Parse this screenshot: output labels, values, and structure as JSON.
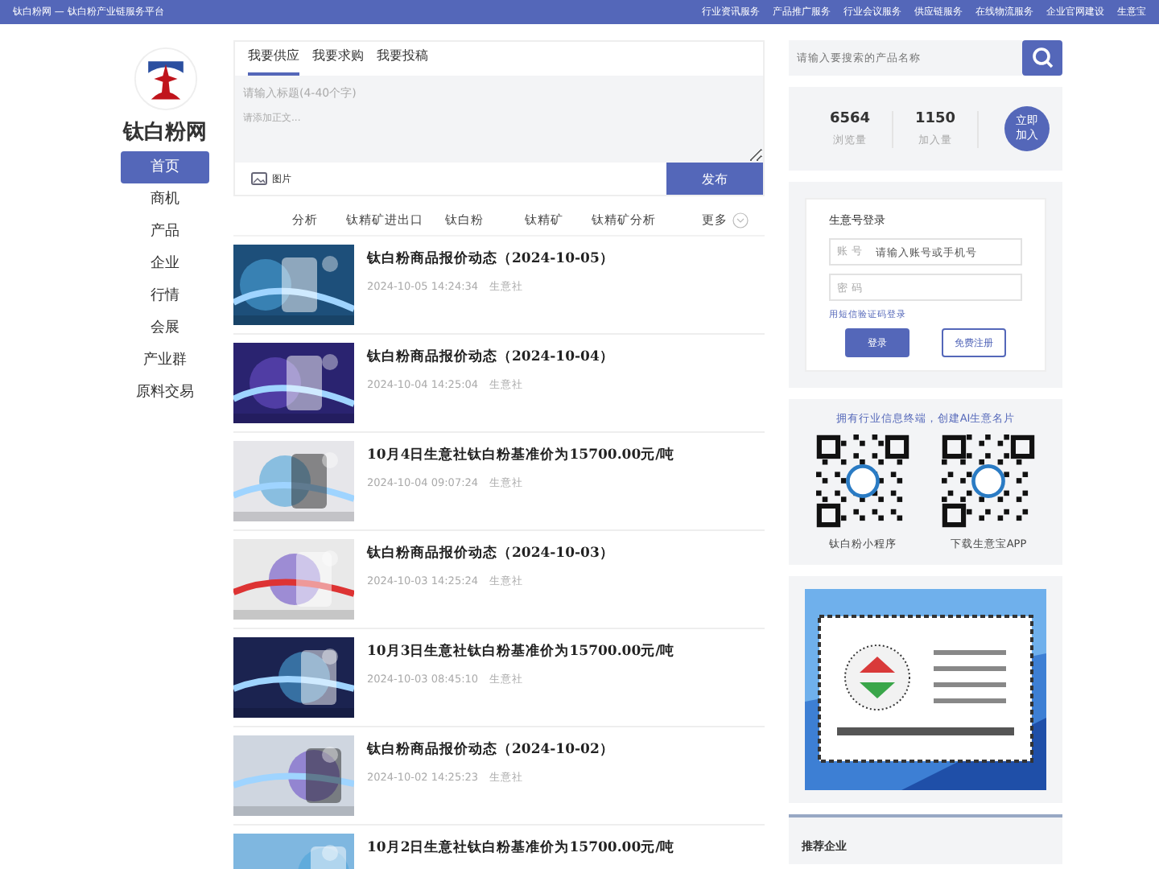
{
  "top_bar": {
    "site_title": "钛白粉网 — 钛白粉产业链服务平台",
    "links": [
      "行业资讯服务",
      "产品推广服务",
      "行业会议服务",
      "供应链服务",
      "在线物流服务",
      "企业官网建设",
      "生意宝"
    ]
  },
  "sidebar": {
    "site_name": "钛白粉网",
    "nav": [
      {
        "label": "首页",
        "selected": true
      },
      {
        "label": "商机",
        "selected": false
      },
      {
        "label": "产品",
        "selected": false
      },
      {
        "label": "企业",
        "selected": false
      },
      {
        "label": "行情",
        "selected": false
      },
      {
        "label": "会展",
        "selected": false
      },
      {
        "label": "产业群",
        "selected": false
      },
      {
        "label": "原料交易",
        "selected": false
      }
    ]
  },
  "post_box": {
    "tabs": [
      {
        "label": "我要供应",
        "selected": true
      },
      {
        "label": "我要求购",
        "selected": false
      },
      {
        "label": "我要投稿",
        "selected": false
      }
    ],
    "title_placeholder": "请输入标题(4-40个字)",
    "body_placeholder": "请添加正文...",
    "image_label": "图片",
    "submit": "发布"
  },
  "categories": {
    "items": [
      "分析",
      "钛精矿进出口",
      "钛白粉",
      "钛精矿",
      "钛精矿分析"
    ],
    "more": "更多"
  },
  "news": [
    {
      "title": "钛白粉商品报价动态（2024-10-05）",
      "time": "2024-10-05 14:24:34",
      "source": "生意社"
    },
    {
      "title": "钛白粉商品报价动态（2024-10-04）",
      "time": "2024-10-04 14:25:04",
      "source": "生意社"
    },
    {
      "title": "10月4日生意社钛白粉基准价为15700.00元/吨",
      "time": "2024-10-04 09:07:24",
      "source": "生意社"
    },
    {
      "title": "钛白粉商品报价动态（2024-10-03）",
      "time": "2024-10-03 14:25:24",
      "source": "生意社"
    },
    {
      "title": "10月3日生意社钛白粉基准价为15700.00元/吨",
      "time": "2024-10-03 08:45:10",
      "source": "生意社"
    },
    {
      "title": "钛白粉商品报价动态（2024-10-02）",
      "time": "2024-10-02 14:25:23",
      "source": "生意社"
    },
    {
      "title": "10月2日生意社钛白粉基准价为15700.00元/吨"
    }
  ],
  "search": {
    "placeholder": "请输入要搜索的产品名称"
  },
  "stats": {
    "items": [
      {
        "value": "6564",
        "label": "浏览量"
      },
      {
        "value": "1150",
        "label": "加入量"
      }
    ],
    "join_button": "立即加入"
  },
  "login": {
    "title": "生意号登录",
    "account_label": "账 号",
    "account_placeholder": "请输入账号或手机号",
    "password_placeholder": "密 码",
    "sms_link": "用短信验证码登录",
    "login_button": "登录",
    "register_button": "免费注册"
  },
  "apps": {
    "headline": "拥有行业信息终端，创建AI生意名片",
    "items": [
      {
        "label": "钛白粉小程序"
      },
      {
        "label": "下载生意宝APP"
      }
    ]
  },
  "recommend": {
    "title": "推荐企业"
  }
}
